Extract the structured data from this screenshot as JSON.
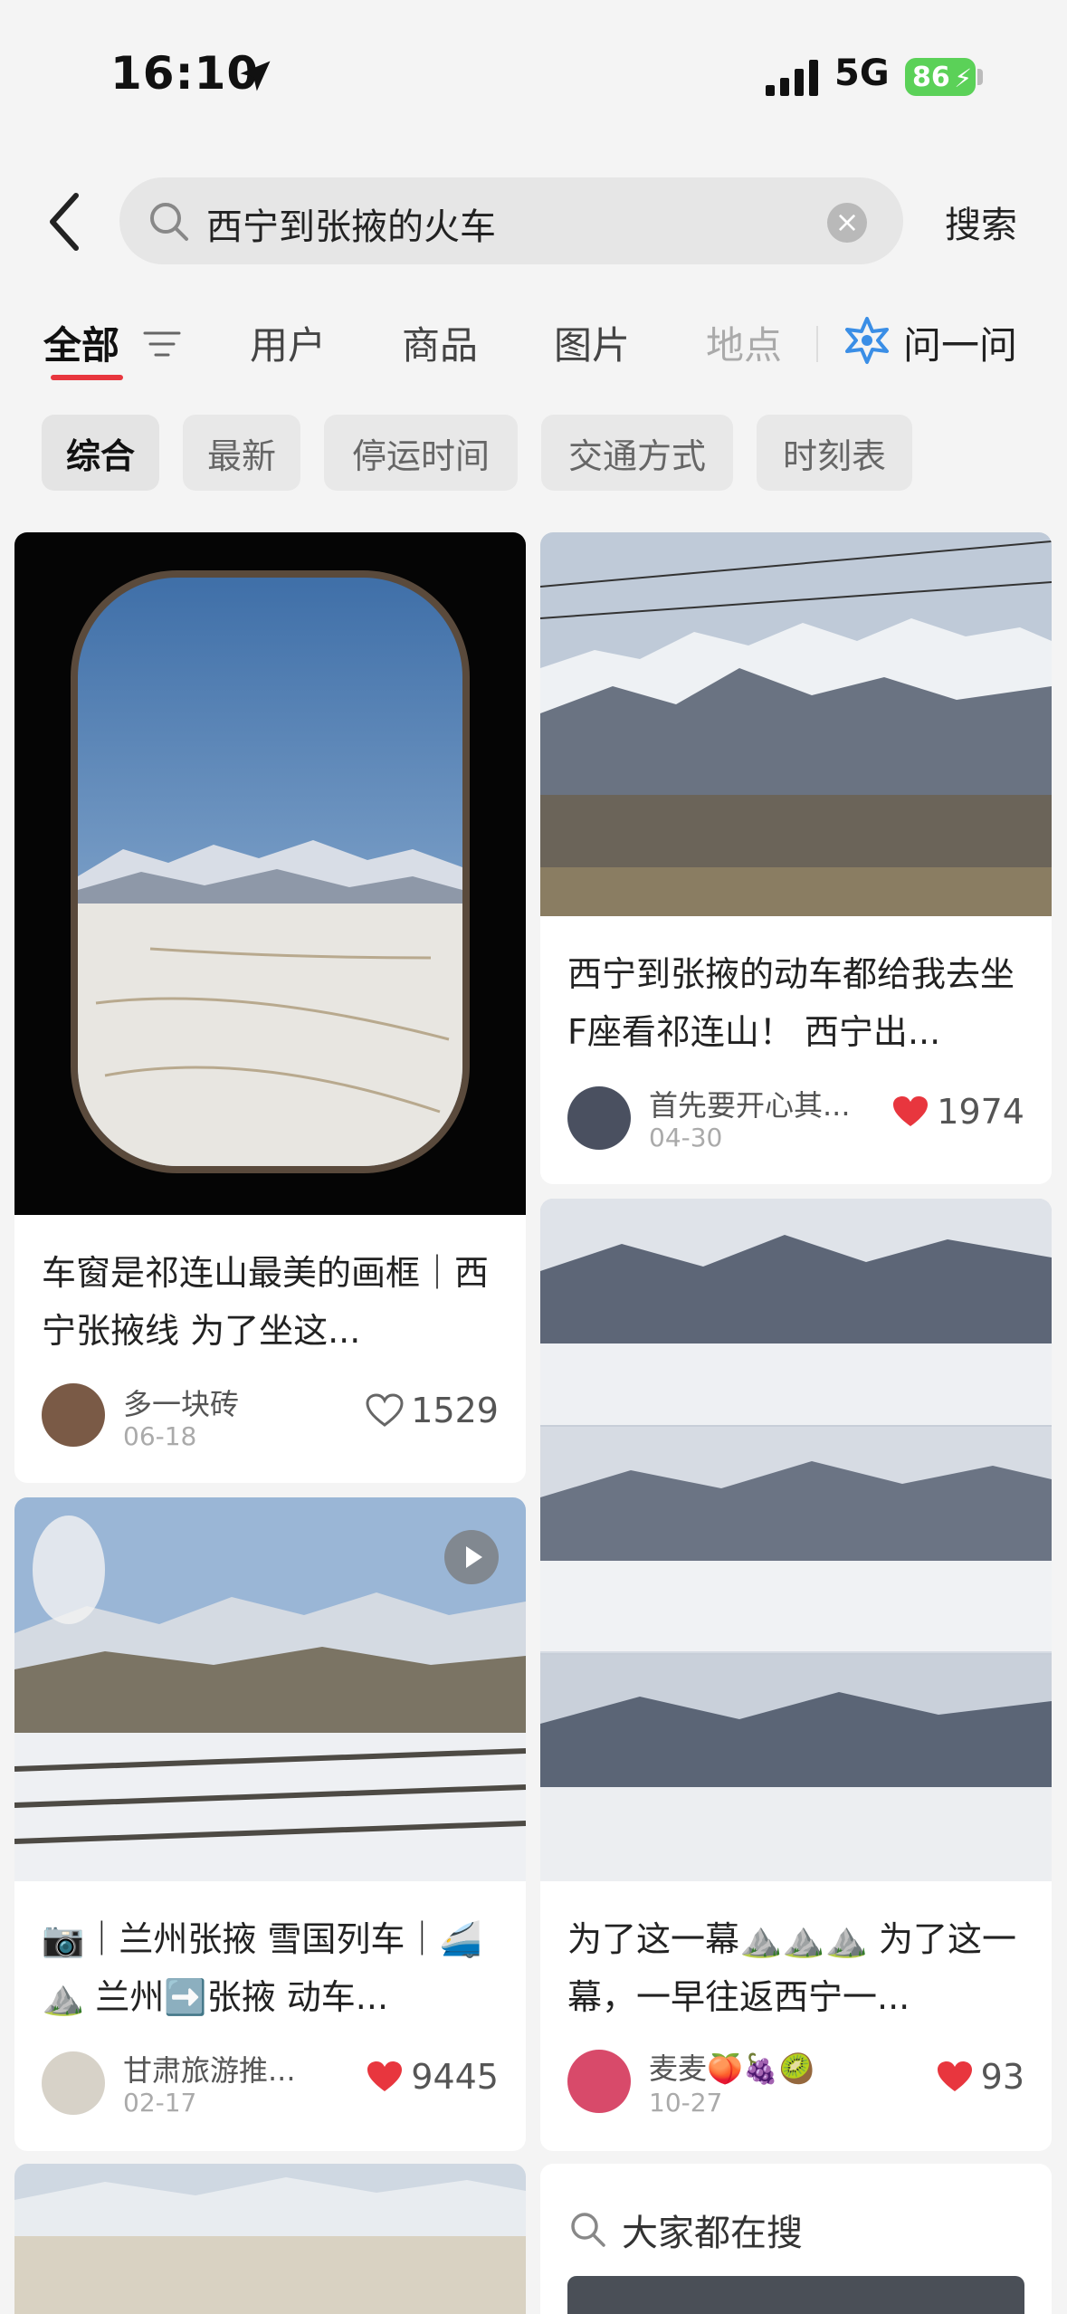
{
  "status_bar": {
    "time": "16:10",
    "network": "5G",
    "battery": "86"
  },
  "search": {
    "query": "西宁到张掖的火车",
    "button": "搜索"
  },
  "tabs": [
    "全部",
    "用户",
    "商品",
    "图片",
    "地点"
  ],
  "ask": "问一问",
  "chips": [
    "综合",
    "最新",
    "停运时间",
    "交通方式",
    "时刻表"
  ],
  "cards": [
    {
      "title": "车窗是祁连山最美的画框｜西宁张掖线 为了坐这...",
      "author": "多一块砖",
      "date": "06-18",
      "likes": "1529",
      "liked": false
    },
    {
      "title": "西宁到张掖的动车都给我去坐F座看祁连山！ 西宁出...",
      "author": "首先要开心其...",
      "date": "04-30",
      "likes": "1974",
      "liked": true
    },
    {
      "title": "📷｜兰州张掖 雪国列车｜🚄⛰️ 兰州➡️张掖 动车...",
      "author": "甘肃旅游推...",
      "date": "02-17",
      "likes": "9445",
      "liked": true
    },
    {
      "title": "为了这一幕⛰️⛰️⛰️ 为了这一幕，一早往返西宁一...",
      "author": "麦麦🍑🍇🥝",
      "date": "10-27",
      "likes": "93",
      "liked": true
    }
  ],
  "hot_search": "大家都在搜",
  "colors": {
    "accent": "#e8363e",
    "heart": "#e8363e",
    "battery": "#5bd158"
  }
}
